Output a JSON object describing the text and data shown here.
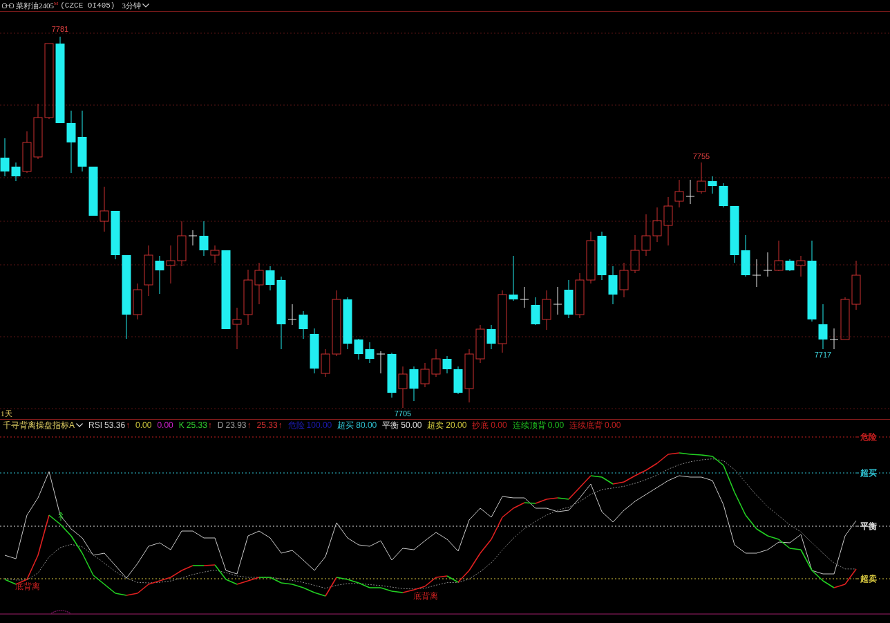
{
  "header": {
    "symbol": "菜籽油2405$^{M}$",
    "code": "(CZCE OI405)",
    "period": "3分钟"
  },
  "price_chart": {
    "extremes": [
      {
        "label": "7781",
        "kind": "high"
      },
      {
        "label": "7755",
        "kind": "high"
      },
      {
        "label": "7705",
        "kind": "low"
      },
      {
        "label": "7717",
        "kind": "low"
      }
    ],
    "range_label": "1天"
  },
  "indicator": {
    "name": "千寻背离操盘指标A",
    "legend": [
      {
        "label": "RSI",
        "value": "53.36",
        "arrow": "↑",
        "color": "#d8d8d8"
      },
      {
        "value": "0.00",
        "color": "#d8d040"
      },
      {
        "value": "0.00",
        "color": "#d020d0"
      },
      {
        "label": "K",
        "value": "25.33",
        "arrow": "↑",
        "color": "#30d030"
      },
      {
        "label": "D",
        "value": "23.93",
        "arrow": "↑",
        "color": "#a0a0a0"
      },
      {
        "value": "25.33",
        "arrow": "↑",
        "color": "#d83030"
      },
      {
        "label": "危险",
        "value": "100.00",
        "color": "#1c1cb4"
      },
      {
        "label": "超买",
        "value": "80.00",
        "color": "#30c4d4"
      },
      {
        "label": "平衡",
        "value": "50.00",
        "color": "#e0e0e0"
      },
      {
        "label": "超卖",
        "value": "20.00",
        "color": "#d8d040"
      },
      {
        "label": "抄底",
        "value": "0.00",
        "color": "#c82020"
      },
      {
        "label": "连续顶背",
        "value": "0.00",
        "color": "#20c020"
      },
      {
        "label": "连续底背",
        "value": "0.00",
        "color": "#c82020"
      }
    ],
    "levels": [
      {
        "label": "危险",
        "color": "#c82020"
      },
      {
        "label": "超买",
        "color": "#30c4d4"
      },
      {
        "label": "平衡",
        "color": "#e0e0e0"
      },
      {
        "label": "超卖",
        "color": "#d8c840"
      }
    ],
    "signals": [
      {
        "label": "底背离"
      },
      {
        "label": "底背离"
      }
    ]
  }
}
